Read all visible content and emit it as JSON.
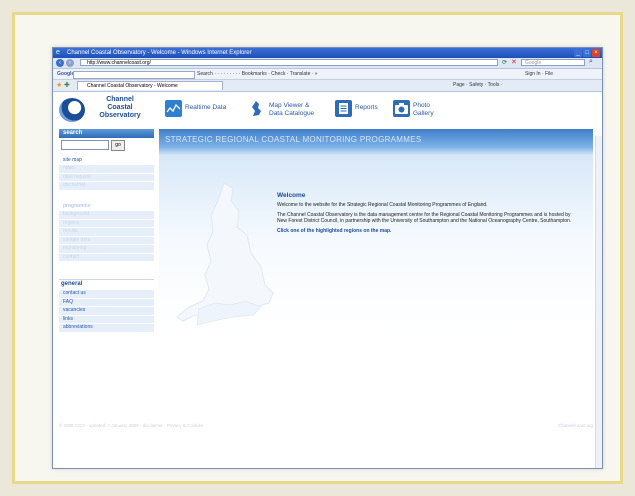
{
  "browser": {
    "title": "Channel Coastal Observatory - Welcome - Windows Internet Explorer",
    "address": "http://www.channelcoast.org/",
    "search_placeholder": "Google",
    "google_label": "Google",
    "google_items": "Search ·  ·  ·  ·  ·  ·  ·  ·  ·  Bookmarks ·  Check ·  Translate · »",
    "google_right": "Sign In ·   File",
    "tab_title": "Channel Coastal Observatory - Welcome",
    "tools": "Page · Safety · Tools ·"
  },
  "site": {
    "logo_text": [
      "Channel",
      "Coastal",
      "Observatory"
    ],
    "nav": [
      {
        "label": "Realtime Data"
      },
      {
        "label": "Map Viewer &\nData Catalogue"
      },
      {
        "label": "Reports"
      },
      {
        "label": "Photo\nGallery"
      }
    ],
    "search_heading": "search",
    "go_label": "go",
    "sitemap_label": "site map",
    "faint_links_1": [
      "news",
      "data request",
      "disclaimer"
    ],
    "programme_heading": "programme",
    "faint_links_2": [
      "background",
      "regions",
      "results",
      "sample data",
      "monitoring",
      "contact"
    ],
    "general_heading": "general",
    "general_links": [
      "contact us",
      "FAQ",
      "vacancies",
      "links",
      "abbreviations"
    ],
    "banner": "STRATEGIC REGIONAL COASTAL MONITORING PROGRAMMES",
    "welcome_title": "Welcome",
    "welcome_p1": "Welcome to the website for the Strategic Regional Coastal Monitoring Programmes of England.",
    "welcome_p2": "The Channel Coastal Observatory is the data management centre for the Regional Coastal Monitoring Programmes and is hosted by New Forest District Council, in partnership with the University of Southampton and the National Oceanography Centre, Southampton.",
    "welcome_p3": "Click one of the highlighted regions on the map.",
    "footer_left": "© 2008 CCO · updated: 7 January 2009 · disclaimer · Privacy & Cookies",
    "footer_right": "Channelcoast.org"
  },
  "colors": {
    "brand": "#1b4d99",
    "banner_top": "#3f7fca",
    "sidebar_head": "#2f6cb8",
    "frame_border": "#e8d98a"
  }
}
